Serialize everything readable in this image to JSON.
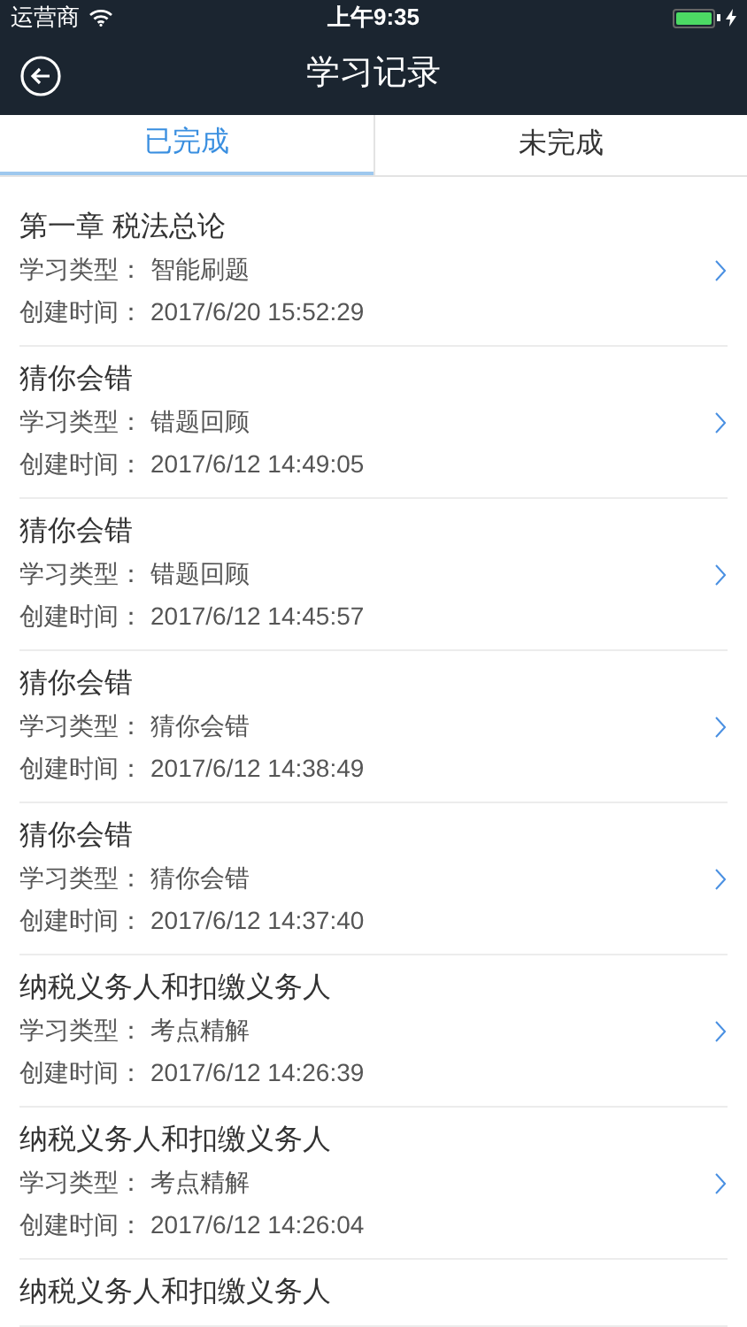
{
  "status_bar": {
    "carrier": "运营商",
    "time": "上午9:35",
    "battery": {
      "level": 1
    }
  },
  "nav": {
    "title": "学习记录"
  },
  "tabs": [
    {
      "label": "已完成",
      "selected": true
    },
    {
      "label": "未完成",
      "selected": false
    }
  ],
  "records": [
    {
      "title": "第一章 税法总论",
      "type_label": "学习类型：",
      "type": "智能刷题",
      "time_label": "创建时间：",
      "time": "2017/6/20 15:52:29"
    },
    {
      "title": "猜你会错",
      "type_label": "学习类型：",
      "type": "错题回顾",
      "time_label": "创建时间：",
      "time": "2017/6/12 14:49:05"
    },
    {
      "title": "猜你会错",
      "type_label": "学习类型：",
      "type": "错题回顾",
      "time_label": "创建时间：",
      "time": "2017/6/12 14:45:57"
    },
    {
      "title": "猜你会错",
      "type_label": "学习类型：",
      "type": "猜你会错",
      "time_label": "创建时间：",
      "time": "2017/6/12 14:38:49"
    },
    {
      "title": "猜你会错",
      "type_label": "学习类型：",
      "type": "猜你会错",
      "time_label": "创建时间：",
      "time": "2017/6/12 14:37:40"
    },
    {
      "title": "纳税义务人和扣缴义务人",
      "type_label": "学习类型：",
      "type": "考点精解",
      "time_label": "创建时间：",
      "time": "2017/6/12 14:26:39"
    },
    {
      "title": "纳税义务人和扣缴义务人",
      "type_label": "学习类型：",
      "type": "考点精解",
      "time_label": "创建时间：",
      "time": "2017/6/12 14:26:04"
    },
    {
      "title": "纳税义务人和扣缴义务人"
    }
  ]
}
